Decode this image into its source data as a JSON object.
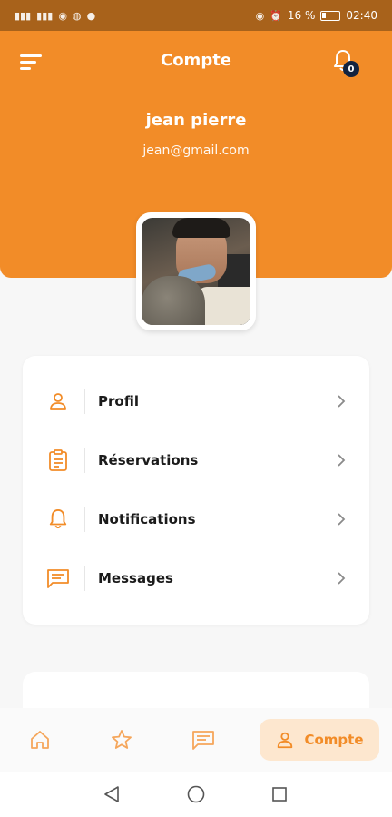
{
  "status_bar": {
    "left_glyphs": [
      "4G",
      "4G",
      "hotspot",
      "whatsapp",
      "messenger"
    ],
    "battery_percent": "16 %",
    "time": "02:40"
  },
  "header": {
    "title": "Compte",
    "notification_count": "0"
  },
  "user": {
    "name": "jean pierre",
    "email": "jean@gmail.com"
  },
  "menu": {
    "items": [
      {
        "label": "Profil",
        "icon": "user-icon"
      },
      {
        "label": "Réservations",
        "icon": "clipboard-icon"
      },
      {
        "label": "Notifications",
        "icon": "bell-icon"
      },
      {
        "label": "Messages",
        "icon": "chat-icon"
      }
    ]
  },
  "bottom_nav": {
    "items": [
      {
        "icon": "home-icon"
      },
      {
        "icon": "star-icon"
      },
      {
        "icon": "chat-icon"
      },
      {
        "icon": "user-icon",
        "label": "Compte",
        "active": true
      }
    ]
  },
  "colors": {
    "accent": "#f28c28",
    "accent_light": "#fde7cf",
    "status_bar": "#a8621b",
    "badge": "#12233f"
  }
}
